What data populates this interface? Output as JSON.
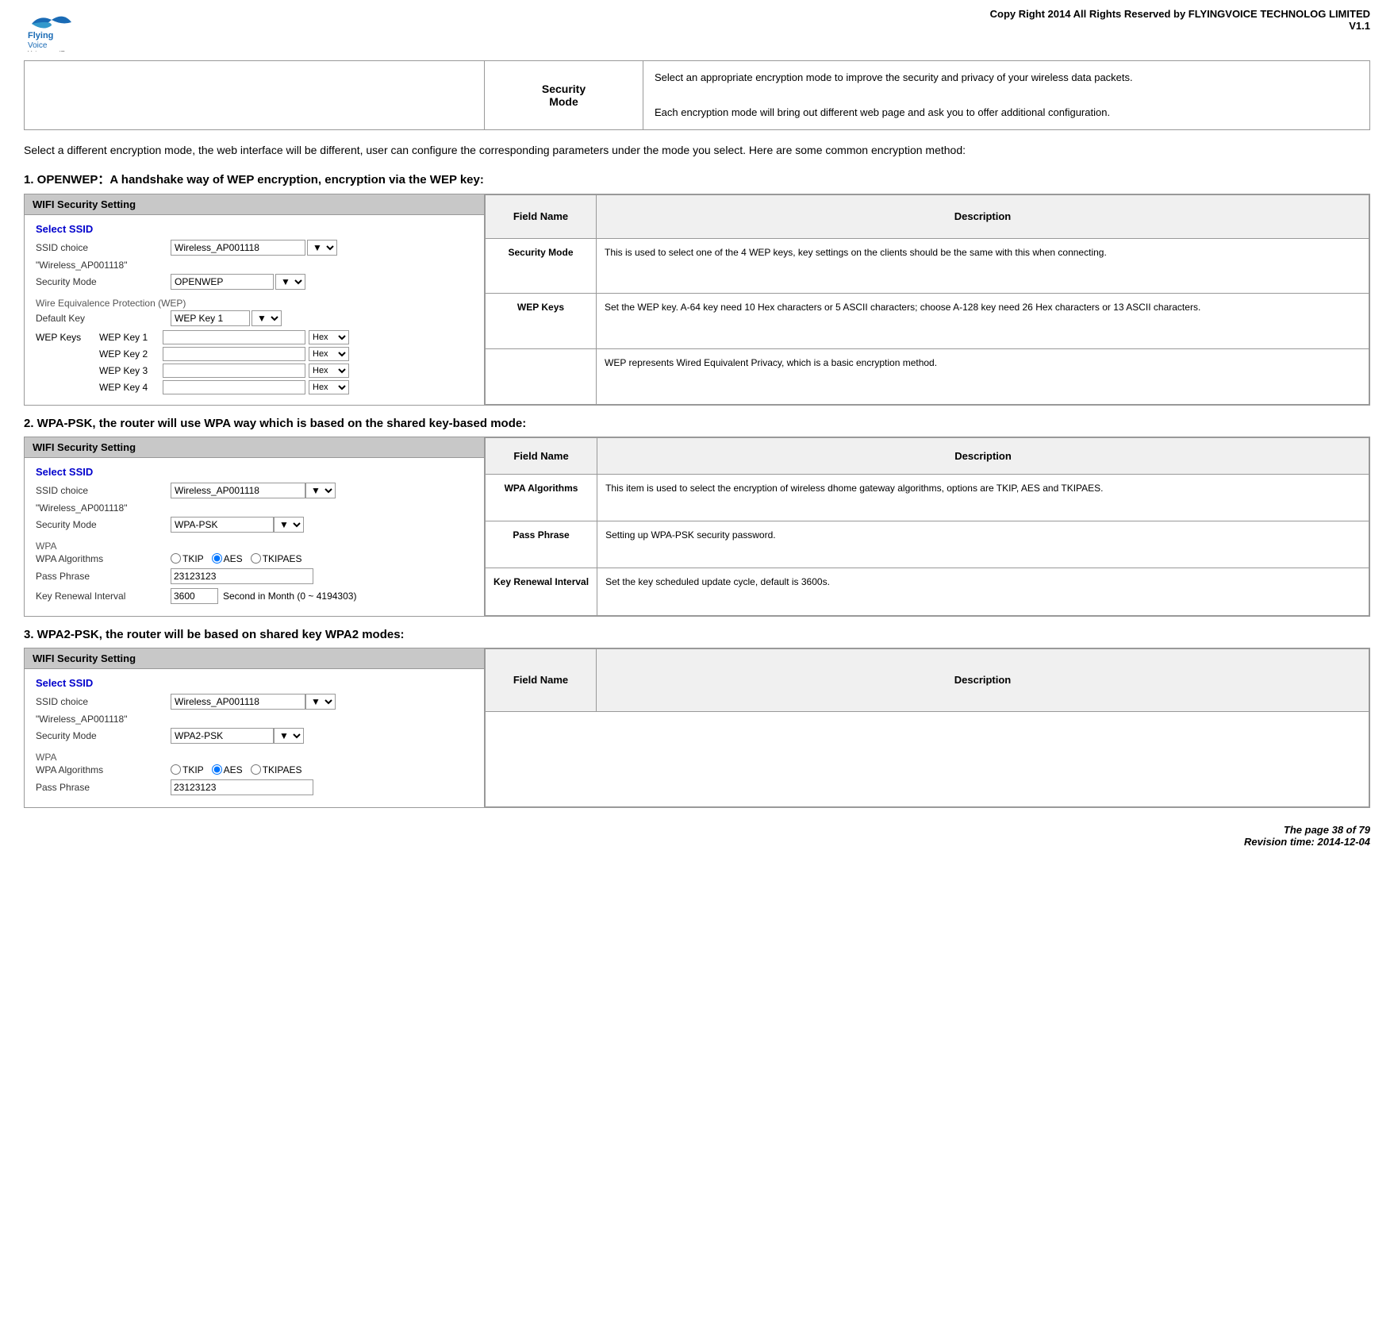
{
  "header": {
    "copyright": "Copy Right 2014 All Rights Reserved by FLYINGVOICE TECHNOLOG LIMITED",
    "version": "V1.1"
  },
  "top_table": {
    "left_cell": "",
    "label": "Security\nMode",
    "description": [
      "Select an appropriate encryption mode to improve the security and privacy of your wireless data packets.",
      "Each encryption mode will bring out different web page and ask you to offer additional configuration."
    ]
  },
  "intro_text": "Select a different encryption mode, the web interface will be different, user can configure the corresponding parameters under the mode you select. Here are some common encryption method:",
  "section1": {
    "heading": "1.  OPENWEP：A handshake way of WEP encryption, encryption via the WEP key:",
    "panel_title": "WIFI Security Setting",
    "select_ssid_label": "Select SSID",
    "ssid_choice_label": "SSID choice",
    "ssid_value": "Wireless_AP001118",
    "ssid_quote": "\"Wireless_AP001118\"",
    "security_mode_label": "Security Mode",
    "security_mode_value": "OPENWEP",
    "wep_section_label": "Wire Equivalence Protection (WEP)",
    "default_key_label": "Default Key",
    "default_key_value": "WEP Key 1",
    "wep_keys_label": "WEP Keys",
    "keys": [
      {
        "label": "WEP Key 1",
        "value": "",
        "format": "Hex"
      },
      {
        "label": "WEP Key 2",
        "value": "",
        "format": "Hex"
      },
      {
        "label": "WEP Key 3",
        "value": "",
        "format": "Hex"
      },
      {
        "label": "WEP Key 4",
        "value": "",
        "format": "Hex"
      }
    ],
    "fields": [
      {
        "name": "Security Mode",
        "description": "This is used to select one of the 4 WEP keys, key settings on the clients should be the same with this when connecting."
      },
      {
        "name": "WEP Keys",
        "description": "Set the WEP key. A-64 key need 10 Hex characters or 5 ASCII characters; choose A-128 key need 26 Hex characters or 13 ASCII characters."
      },
      {
        "name": "",
        "description": "WEP represents Wired Equivalent Privacy, which is a basic encryption method."
      }
    ],
    "col_field": "Field Name",
    "col_desc": "Description"
  },
  "section2": {
    "heading": "2.  WPA-PSK, the router will use WPA way which is based on the shared key-based mode:",
    "panel_title": "WIFI Security Setting",
    "select_ssid_label": "Select SSID",
    "ssid_choice_label": "SSID choice",
    "ssid_value": "Wireless_AP001118",
    "ssid_quote": "\"Wireless_AP001118\"",
    "security_mode_label": "Security Mode",
    "security_mode_value": "WPA-PSK",
    "wpa_label": "WPA",
    "wpa_algorithms_label": "WPA Algorithms",
    "wpa_algorithms_options": [
      "TKIP",
      "AES",
      "TKIPAES"
    ],
    "wpa_algorithms_selected": "AES",
    "pass_phrase_label": "Pass Phrase",
    "pass_phrase_value": "23123123",
    "key_renewal_label": "Key Renewal Interval",
    "key_renewal_value": "3600",
    "key_renewal_suffix": "Second in Month  (0 ~ 4194303)",
    "fields": [
      {
        "name": "WPA Algorithms",
        "description": "This item is used to select the encryption of wireless dhome gateway algorithms, options are TKIP, AES and TKIPAES."
      },
      {
        "name": "Pass Phrase",
        "description": "Setting up WPA-PSK security password."
      },
      {
        "name": "Key Renewal Interval",
        "description": "Set the key scheduled update cycle, default is 3600s."
      }
    ],
    "col_field": "Field Name",
    "col_desc": "Description"
  },
  "section3": {
    "heading": "3.  WPA2-PSK, the router will be based on shared key WPA2 modes:",
    "panel_title": "WIFI Security Setting",
    "select_ssid_label": "Select SSID",
    "ssid_choice_label": "SSID choice",
    "ssid_value": "Wireless_AP001118",
    "ssid_quote": "\"Wireless_AP001118\"",
    "security_mode_label": "Security Mode",
    "security_mode_value": "WPA2-PSK",
    "wpa_label": "WPA",
    "wpa_algorithms_label": "WPA Algorithms",
    "wpa_algorithms_selected": "AES",
    "pass_phrase_label": "Pass Phrase",
    "pass_phrase_value": "23123123",
    "col_field": "Field Name",
    "col_desc": "Description"
  },
  "footer": {
    "page": "The page 38 of 79",
    "revision": "Revision time: 2014-12-04"
  }
}
